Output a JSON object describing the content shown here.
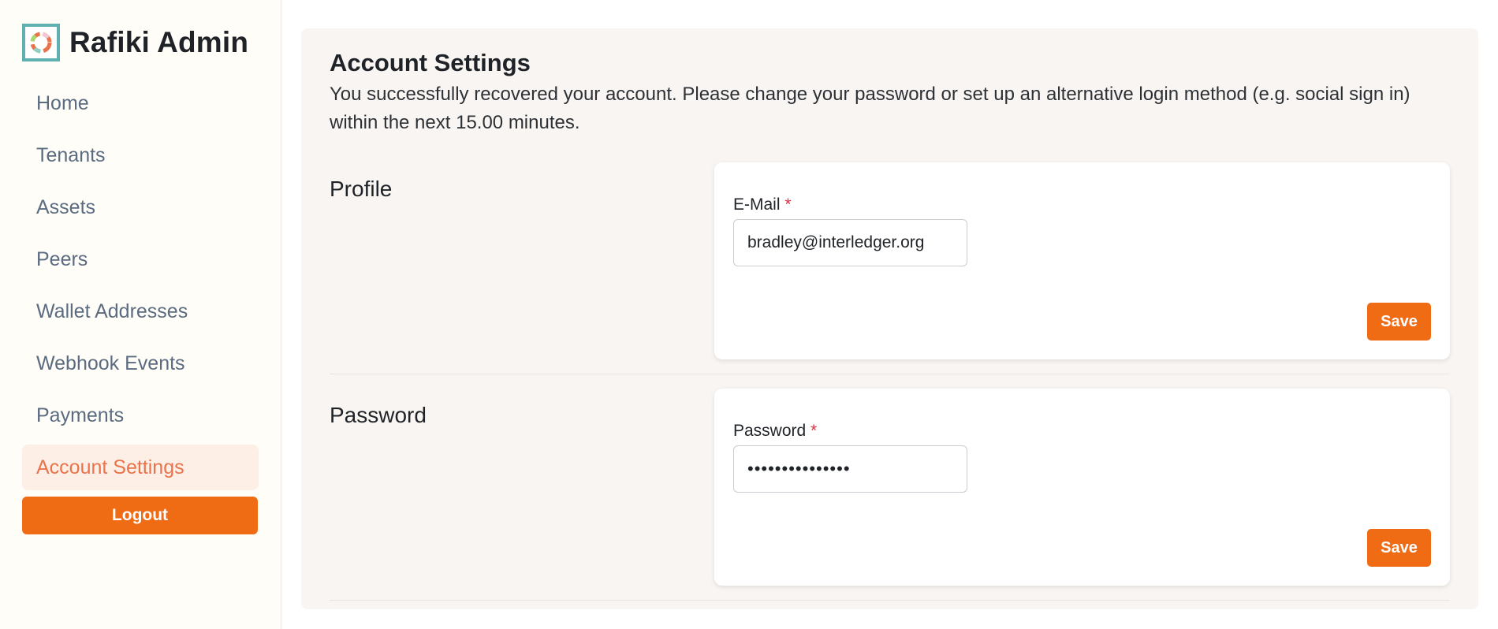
{
  "app": {
    "title": "Rafiki Admin",
    "logo_icon": "rafiki-ring-logo-icon",
    "accent": "#ef6c14",
    "logo_border": "#5eb1b0"
  },
  "sidebar": {
    "items": [
      {
        "label": "Home",
        "active": false
      },
      {
        "label": "Tenants",
        "active": false
      },
      {
        "label": "Assets",
        "active": false
      },
      {
        "label": "Peers",
        "active": false
      },
      {
        "label": "Wallet Addresses",
        "active": false
      },
      {
        "label": "Webhook Events",
        "active": false
      },
      {
        "label": "Payments",
        "active": false
      },
      {
        "label": "Account Settings",
        "active": true
      }
    ],
    "logout_label": "Logout"
  },
  "page": {
    "title": "Account Settings",
    "description": "You successfully recovered your account. Please change your password or set up an alternative login method (e.g. social sign in) within the next 15.00 minutes."
  },
  "profile": {
    "section_label": "Profile",
    "field_label": "E-Mail",
    "required_mark": "*",
    "value": "bradley@interledger.org",
    "save_label": "Save"
  },
  "password": {
    "section_label": "Password",
    "field_label": "Password",
    "required_mark": "*",
    "value": "passwordpasswor",
    "save_label": "Save"
  }
}
